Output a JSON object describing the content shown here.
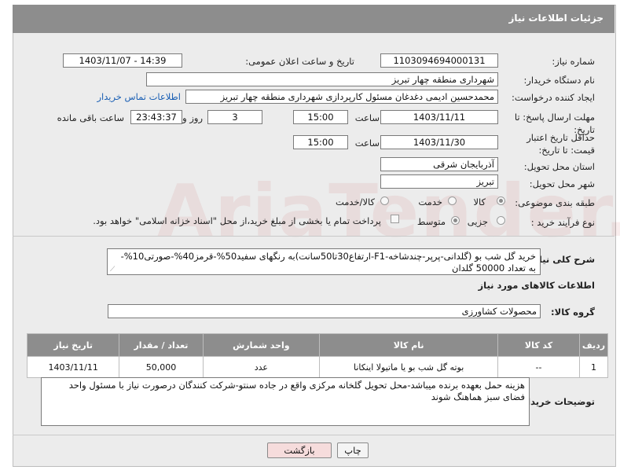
{
  "header": {
    "title": "جزئیات اطلاعات نیاز"
  },
  "watermark": "AriaTender.net",
  "form": {
    "need_number_label": "شماره نیاز:",
    "need_number": "1103094694000131",
    "announce_label": "تاریخ و ساعت اعلان عمومی:",
    "announce_value": "1403/11/07 - 14:39",
    "buyer_org_label": "نام دستگاه خریدار:",
    "buyer_org": "شهرداری منطقه چهار تبریز",
    "creator_label": "ایجاد کننده درخواست:",
    "creator": "محمدحسین ادیمی دغدغان مسئول کارپردازی شهرداری منطقه چهار تبریز",
    "contact_link": "اطلاعات تماس خریدار",
    "deadline_label": "مهلت ارسال پاسخ: تا تاریخ:",
    "deadline_date": "1403/11/11",
    "time_label": "ساعت",
    "deadline_time": "15:00",
    "days_value": "3",
    "days_label": "روز و",
    "remaining_time": "23:43:37",
    "remaining_label": "ساعت باقی مانده",
    "validity_label": "حداقل تاریخ اعتبار قیمت: تا تاریخ:",
    "validity_date": "1403/11/30",
    "validity_time": "15:00",
    "province_label": "استان محل تحویل:",
    "province": "آذربایجان شرقی",
    "city_label": "شهر محل تحویل:",
    "city": "تبریز",
    "category_label": "طبقه بندی موضوعی:",
    "category_options": [
      "کالا",
      "خدمت",
      "کالا/خدمت"
    ],
    "process_label": "نوع فرآیند خرید :",
    "process_options": [
      "جزیی",
      "متوسط"
    ],
    "payment_note": "پرداخت تمام یا بخشی از مبلغ خرید،از محل \"اسناد خزانه اسلامی\" خواهد بود."
  },
  "summary": {
    "label": "شرح کلی نیاز:",
    "text": "خرید گل شب بو (گلدانی-پرپر-چندشاخه-F1-ارتفاع30تا50سانت)به رنگهای سفید50%-قرمز40%-صورتی10%- به تعداد 50000 گلدان"
  },
  "goods": {
    "section_title": "اطلاعات کالاهای مورد نیاز",
    "group_label": "گروه کالا:",
    "group_value": "محصولات کشاورزی",
    "columns": [
      "ردیف",
      "کد کالا",
      "نام کالا",
      "واحد شمارش",
      "تعداد / مقدار",
      "تاریخ نیاز"
    ],
    "rows": [
      {
        "row": "1",
        "code": "--",
        "name": "بوته گل شب بو یا ماتیولا اینکانا",
        "unit": "عدد",
        "qty": "50,000",
        "date": "1403/11/11"
      }
    ]
  },
  "buyer_notes": {
    "label": "توضیحات خریدار:",
    "text": "هزینه حمل بعهده برنده میباشد-محل تحویل گلخانه مرکزی واقع در جاده سنتو-شرکت کنندگان درصورت نیاز با مسئول واحد فضای سبز هماهنگ شوند"
  },
  "buttons": {
    "print": "چاپ",
    "back": "بازگشت"
  },
  "colors": {
    "header": "#8d8d8d",
    "panel": "#ececec",
    "link": "#1a5fb4",
    "back_button": "#f6dcdc"
  }
}
